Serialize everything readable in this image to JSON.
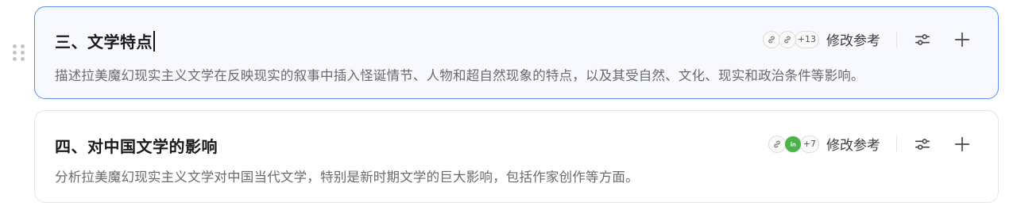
{
  "sections": [
    {
      "title": "三、文学特点",
      "description": "描述拉美魔幻现实主义文学在反映现实的叙事中插入怪诞情节、人物和超自然现象的特点，以及其受自然、文化、现实和政治条件等影响。",
      "ref_count": "+13",
      "ref_label": "修改参考",
      "ref_icons": [
        "link-icon",
        "link-icon"
      ],
      "active": true
    },
    {
      "title": "四、对中国文学的影响",
      "description": "分析拉美魔幻现实主义文学对中国当代文学，特别是新时期文学的巨大影响，包括作家创作等方面。",
      "ref_count": "+7",
      "ref_label": "修改参考",
      "ref_icons": [
        "link-icon",
        "source-logo-icon"
      ],
      "active": false
    }
  ],
  "colors": {
    "active_border": "#5b8def",
    "active_bg": "#f7f9fe",
    "logo_green": "#4bb34b"
  }
}
